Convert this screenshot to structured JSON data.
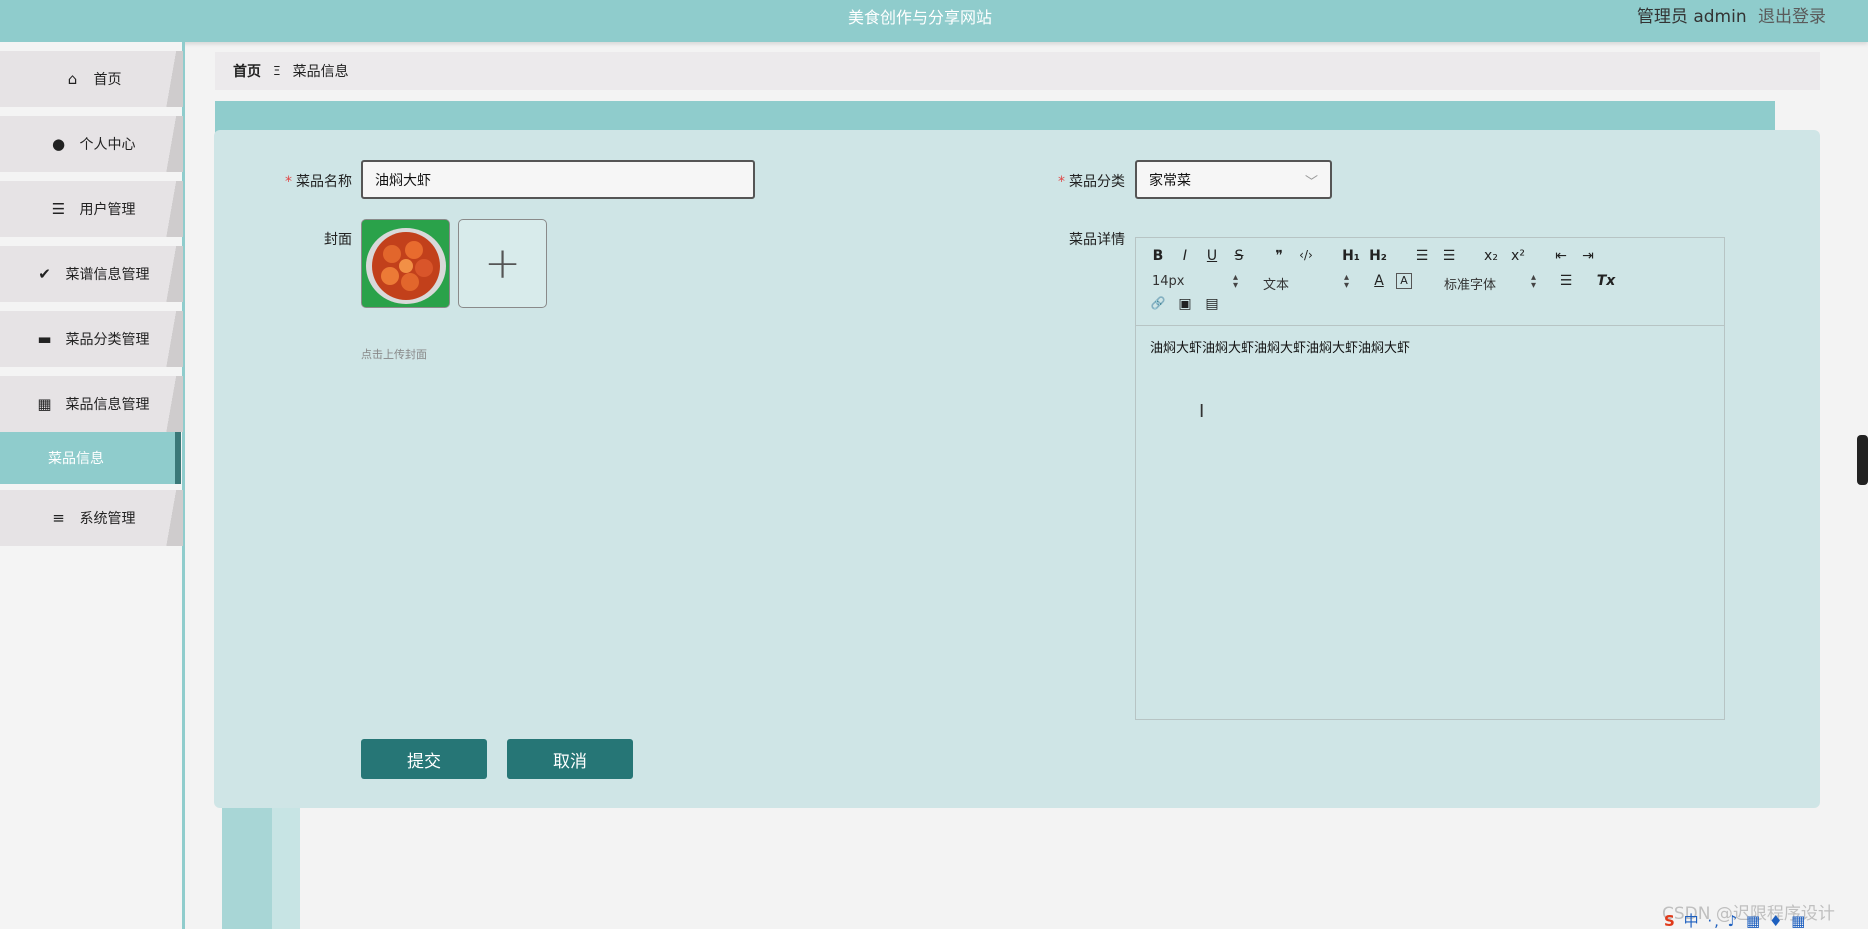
{
  "header": {
    "site_title": "美食创作与分享网站",
    "admin_label": "管理员 admin",
    "logout_label": "退出登录"
  },
  "sidebar": {
    "items": [
      {
        "label": "首页",
        "icon": "home-icon"
      },
      {
        "label": "个人中心",
        "icon": "user-icon"
      },
      {
        "label": "用户管理",
        "icon": "list-icon"
      },
      {
        "label": "菜谱信息管理",
        "icon": "clipboard-check-icon"
      },
      {
        "label": "菜品分类管理",
        "icon": "monitor-icon"
      },
      {
        "label": "菜品信息管理",
        "icon": "grid-icon"
      },
      {
        "label": "系统管理",
        "icon": "menu-lines-icon"
      }
    ],
    "active_sub": "菜品信息"
  },
  "breadcrumb": {
    "home": "首页",
    "separator": "Ξ",
    "current": "菜品信息"
  },
  "form": {
    "name_label": "菜品名称",
    "name_value": "油焖大虾",
    "category_label": "菜品分类",
    "category_value": "家常菜",
    "cover_label": "封面",
    "cover_hint": "点击上传封面",
    "detail_label": "菜品详情",
    "required_mark": "*"
  },
  "editor": {
    "font_size": "14px",
    "paragraph": "文本",
    "font_family": "标准字体",
    "content": "油焖大虾油焖大虾油焖大虾油焖大虾油焖大虾",
    "toolbar_row1": [
      "B",
      "I",
      "U",
      "S",
      "❞",
      "</>",
      "H1",
      "H2",
      "ol",
      "ul",
      "x₂",
      "x²",
      "outdent",
      "indent"
    ],
    "toolbar_glyphs": {
      "bold": "B",
      "italic": "I",
      "underline": "U",
      "strike": "S",
      "quote": "❞",
      "code": "‹/›",
      "h1": "H₁",
      "h2": "H₂",
      "ol": "☰",
      "ul": "☰",
      "sub": "x₂",
      "sup": "x²",
      "outdent": "⇤",
      "indent": "⇥",
      "color": "A",
      "bg": "A",
      "align": "☰",
      "clean": "Tx",
      "link": "🔗",
      "image": "▣",
      "video": "▤"
    }
  },
  "buttons": {
    "submit": "提交",
    "cancel": "取消"
  },
  "overlay": {
    "watermark": "CSDN @迟限程序设计",
    "ime_text": "中 ·, ♪ ▦ ♦ ▦"
  },
  "colors": {
    "header": "#8fcccc",
    "card": "#cfe5e6",
    "button": "#267676",
    "required": "#e04848"
  }
}
